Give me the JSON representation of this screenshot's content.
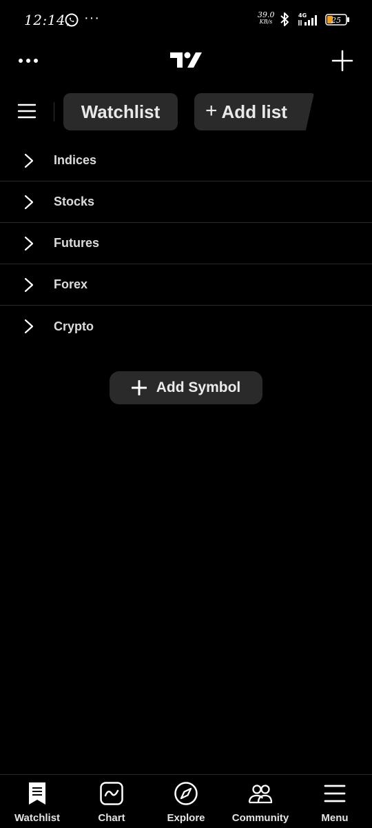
{
  "status_bar": {
    "time": "12:14",
    "overflow": "···",
    "net_speed_value": "39.0",
    "net_speed_unit": "KB/s",
    "network_type": "4G",
    "battery_level": "25",
    "icons": [
      "whatsapp-icon",
      "bluetooth-icon",
      "signal-icon",
      "battery-icon"
    ]
  },
  "header": {
    "logo": "tradingview-logo",
    "more_icon": "more-horizontal-icon",
    "add_icon": "plus-icon"
  },
  "tabs": {
    "menu_icon": "hamburger-icon",
    "active_tab": "Watchlist",
    "add_list_plus": "+",
    "add_list": "Add list"
  },
  "sections": [
    {
      "label": "Indices"
    },
    {
      "label": "Stocks"
    },
    {
      "label": "Futures"
    },
    {
      "label": "Forex"
    },
    {
      "label": "Crypto"
    }
  ],
  "add_symbol": {
    "label": "Add Symbol"
  },
  "bottom_nav": [
    {
      "label": "Watchlist",
      "icon": "watchlist-icon"
    },
    {
      "label": "Chart",
      "icon": "chart-icon"
    },
    {
      "label": "Explore",
      "icon": "compass-icon"
    },
    {
      "label": "Community",
      "icon": "community-icon"
    },
    {
      "label": "Menu",
      "icon": "menu-icon"
    }
  ],
  "colors": {
    "background": "#000000",
    "surface": "#2a2a2a",
    "text": "#ffffff",
    "battery": "#f0a020"
  }
}
